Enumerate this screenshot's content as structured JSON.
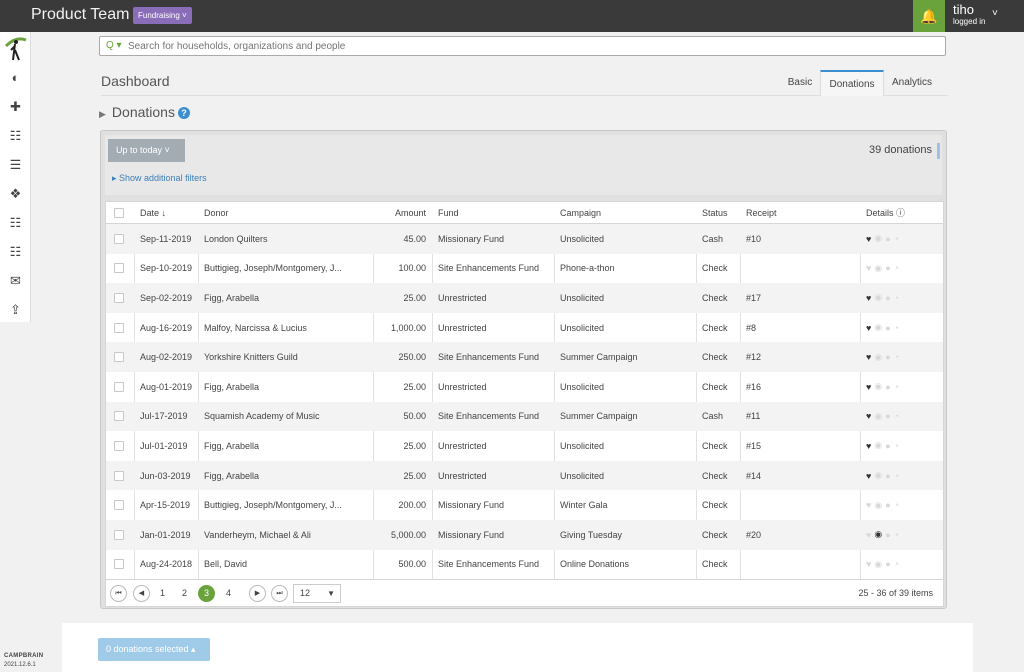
{
  "header": {
    "app_title": "Product Team",
    "context_badge": "Fundraising ˅",
    "bell_icon": "🔔",
    "user_name": "tiho",
    "user_status": "logged in",
    "user_menu_chevron": "˅"
  },
  "sidebar": {
    "icons": [
      "dashboard-icon",
      "plus-icon",
      "sitemap-icon",
      "list-icon",
      "tags-icon",
      "reports-icon",
      "document-icon",
      "envelope-icon",
      "upload-icon"
    ],
    "glyphs": [
      "◐",
      "✚",
      "☷",
      "☰",
      "❖",
      "☷",
      "☷",
      "✉",
      "⇪"
    ]
  },
  "search": {
    "icon": "Q ▾",
    "placeholder": "Search for households, organizations and people"
  },
  "page": {
    "title": "Dashboard",
    "tabs": [
      "Basic",
      "Donations",
      "Analytics"
    ],
    "active_tab": "Donations"
  },
  "section": {
    "arrow": "▶",
    "title": "Donations",
    "help": "?"
  },
  "filters": {
    "period_label": "Up to today ˅",
    "count": "39 donations",
    "additional_filters": "▸  Show additional filters"
  },
  "table": {
    "columns": [
      "",
      "Date ↓",
      "Donor",
      "Amount",
      "Fund",
      "Campaign",
      "Status",
      "Receipt",
      "Details ⓘ"
    ],
    "rows": [
      {
        "date": "Sep-11-2019",
        "donor": "London Quilters",
        "amount": "45.00",
        "fund": "Missionary Fund",
        "campaign": "Unsolicited",
        "status": "Cash",
        "receipt": "#10",
        "heart": true,
        "eye": false
      },
      {
        "date": "Sep-10-2019",
        "donor": "Buttigieg, Joseph/Montgomery, J...",
        "amount": "100.00",
        "fund": "Site Enhancements Fund",
        "campaign": "Phone-a-thon",
        "status": "Check",
        "receipt": "",
        "heart": false,
        "eye": false
      },
      {
        "date": "Sep-02-2019",
        "donor": "Figg, Arabella",
        "amount": "25.00",
        "fund": "Unrestricted",
        "campaign": "Unsolicited",
        "status": "Check",
        "receipt": "#17",
        "heart": true,
        "eye": false
      },
      {
        "date": "Aug-16-2019",
        "donor": "Malfoy, Narcissa & Lucius",
        "amount": "1,000.00",
        "fund": "Unrestricted",
        "campaign": "Unsolicited",
        "status": "Check",
        "receipt": "#8",
        "heart": true,
        "eye": false
      },
      {
        "date": "Aug-02-2019",
        "donor": "Yorkshire Knitters Guild",
        "amount": "250.00",
        "fund": "Site Enhancements Fund",
        "campaign": "Summer Campaign",
        "status": "Check",
        "receipt": "#12",
        "heart": true,
        "eye": false
      },
      {
        "date": "Aug-01-2019",
        "donor": "Figg, Arabella",
        "amount": "25.00",
        "fund": "Unrestricted",
        "campaign": "Unsolicited",
        "status": "Check",
        "receipt": "#16",
        "heart": true,
        "eye": false
      },
      {
        "date": "Jul-17-2019",
        "donor": "Squamish Academy of Music",
        "amount": "50.00",
        "fund": "Site Enhancements Fund",
        "campaign": "Summer Campaign",
        "status": "Cash",
        "receipt": "#11",
        "heart": true,
        "eye": false
      },
      {
        "date": "Jul-01-2019",
        "donor": "Figg, Arabella",
        "amount": "25.00",
        "fund": "Unrestricted",
        "campaign": "Unsolicited",
        "status": "Check",
        "receipt": "#15",
        "heart": true,
        "eye": false
      },
      {
        "date": "Jun-03-2019",
        "donor": "Figg, Arabella",
        "amount": "25.00",
        "fund": "Unrestricted",
        "campaign": "Unsolicited",
        "status": "Check",
        "receipt": "#14",
        "heart": true,
        "eye": false
      },
      {
        "date": "Apr-15-2019",
        "donor": "Buttigieg, Joseph/Montgomery, J...",
        "amount": "200.00",
        "fund": "Missionary Fund",
        "campaign": "Winter Gala",
        "status": "Check",
        "receipt": "",
        "heart": false,
        "eye": false
      },
      {
        "date": "Jan-01-2019",
        "donor": "Vanderheym, Michael & Ali",
        "amount": "5,000.00",
        "fund": "Missionary Fund",
        "campaign": "Giving Tuesday",
        "status": "Check",
        "receipt": "#20",
        "heart": false,
        "eye": true
      },
      {
        "date": "Aug-24-2018",
        "donor": "Bell, David",
        "amount": "500.00",
        "fund": "Site Enhancements Fund",
        "campaign": "Online Donations",
        "status": "Check",
        "receipt": "",
        "heart": false,
        "eye": false
      }
    ]
  },
  "pager": {
    "first": "⏮",
    "prev": "◀",
    "next": "▶",
    "last": "⏭",
    "pages": [
      "1",
      "2",
      "3",
      "4"
    ],
    "current": "3",
    "page_size": "12",
    "page_size_caret": "▼",
    "range": "25 - 36 of 39 items"
  },
  "footer": {
    "selected_button": "0 donations selected ▴",
    "brand": "CAMPBRAIN",
    "version": "2021.12.6.1"
  },
  "colors": {
    "topbar": "#3a3a3a",
    "accent_green": "#6aa23c",
    "badge_purple": "#8a6db8",
    "link_blue": "#3b7fb9"
  }
}
